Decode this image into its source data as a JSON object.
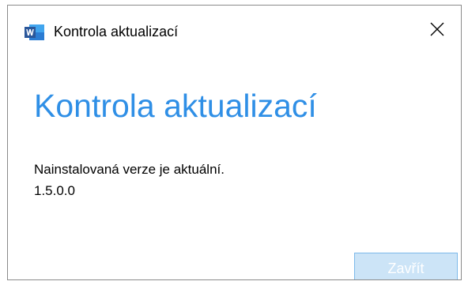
{
  "window": {
    "title": "Kontrola aktualizací",
    "app_icon": "word-icon",
    "close_icon": "close-icon"
  },
  "content": {
    "heading": "Kontrola aktualizací",
    "message": "Nainstalovaná verze je aktuální.",
    "version": "1.5.0.0"
  },
  "buttons": {
    "close_label": "Zavřít"
  },
  "colors": {
    "heading": "#2f8fe6",
    "button_bg": "#cce4f7",
    "button_border": "#7db9ea",
    "word_blue": "#2b579a"
  }
}
